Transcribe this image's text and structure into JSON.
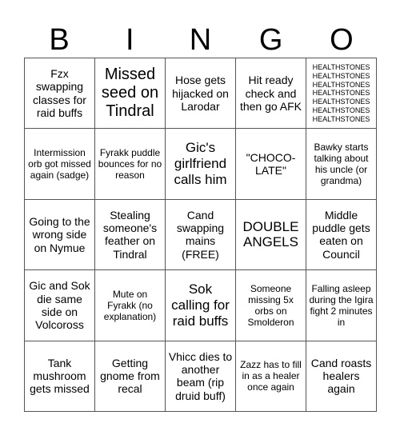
{
  "header": {
    "letters": [
      "B",
      "I",
      "N",
      "G",
      "O"
    ]
  },
  "cells": [
    "Fzx swapping classes for raid buffs",
    "Missed seed on Tindral",
    "Hose gets hijacked on Larodar",
    "Hit ready check and then go AFK",
    "HEALTHSTONES HEALTHSTONES HEALTHSTONES HEALTHSTONES HEALTHSTONES HEALTHSTONES HEALTHSTONES",
    "Intermission orb got missed again (sadge)",
    "Fyrakk puddle bounces for no reason",
    "Gic's girlfriend calls him",
    "\"CHOCO-LATE\"",
    "Bawky starts talking about his uncle (or grandma)",
    "Going to the wrong side on Nymue",
    "Stealing someone's feather on Tindral",
    "Cand swapping mains (FREE)",
    "DOUBLE ANGELS",
    "Middle puddle gets eaten on Council",
    "Gic and Sok die same side on Volcoross",
    "Mute on Fyrakk (no explanation)",
    "Sok calling for raid buffs",
    "Someone missing 5x orbs on Smolderon",
    "Falling asleep during the Igira fight 2 minutes in",
    "Tank mushroom gets missed",
    "Getting gnome from recal",
    "Vhicc dies to another beam (rip druid buff)",
    "Zazz has to fill in as a healer once again",
    "Cand roasts healers again"
  ]
}
